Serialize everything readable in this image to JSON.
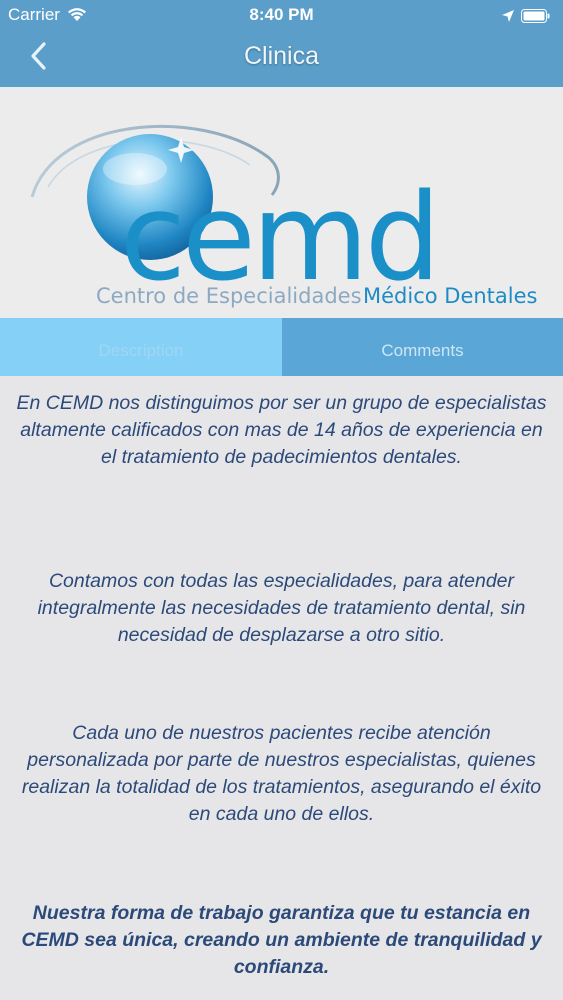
{
  "status_bar": {
    "carrier": "Carrier",
    "time": "8:40 PM",
    "icons": [
      "wifi-icon",
      "location-icon",
      "battery-icon"
    ]
  },
  "nav": {
    "back_icon": "chevron-left-icon",
    "title": "Clinica"
  },
  "banner": {
    "logo_text": "cemd",
    "tagline_part1": "Centro de Especialidades",
    "tagline_part2": "Médico Dentales"
  },
  "tabs": [
    {
      "label": "Description",
      "selected": true
    },
    {
      "label": "Comments",
      "selected": false
    }
  ],
  "content": {
    "paragraphs": [
      "En CEMD nos distinguimos por ser un grupo de especialistas altamente calificados con mas de 14 años de experiencia en el tratamiento de padecimientos dentales.",
      "Contamos con todas las especialidades, para atender integralmente  las necesidades de tratamiento dental, sin necesidad de desplazarse a otro sitio.",
      "Cada uno de nuestros pacientes recibe atención personalizada por parte de nuestros especialistas, quienes realizan la totalidad de los tratamientos, asegurando el éxito en cada uno de ellos.",
      "Nuestra forma de trabajo garantiza que tu estancia en CEMD sea única, creando un ambiente de tranquilidad y confianza."
    ]
  },
  "colors": {
    "header": "#5a9ec9",
    "tab_selected": "#84d0f6",
    "tab_unselected": "#5aa7d7",
    "body_text": "#2c4a79",
    "logo_blue": "#1a8fc8"
  }
}
